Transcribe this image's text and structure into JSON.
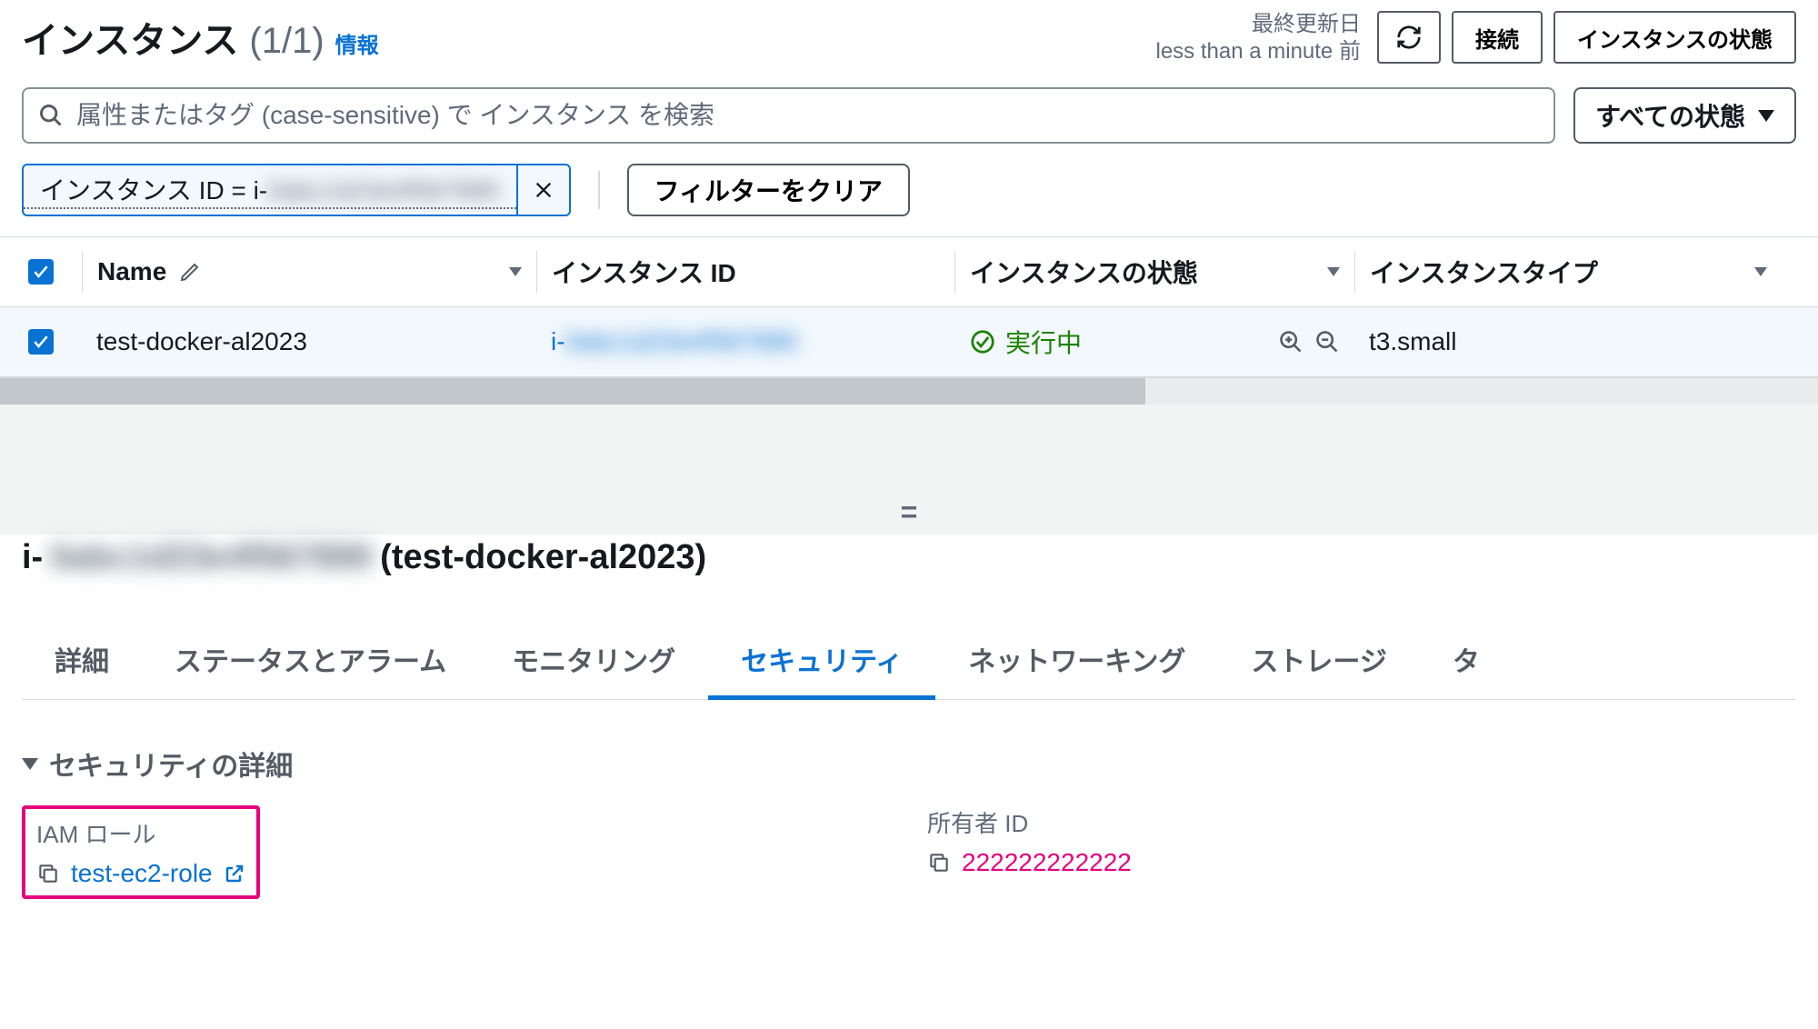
{
  "header": {
    "title": "インスタンス",
    "count": "(1/1)",
    "info_label": "情報",
    "last_updated_label": "最終更新日",
    "last_updated_value": "less than a minute 前",
    "connect_label": "接続",
    "state_action_label": "インスタンスの状態"
  },
  "search": {
    "placeholder": "属性またはタグ (case-sensitive) で インスタンス を検索",
    "state_filter_label": "すべての状態"
  },
  "chips": {
    "filter_prefix": "インスタンス ID = i-",
    "filter_hidden": "0abc1d23e4f567890",
    "clear_label": "フィルターをクリア"
  },
  "table": {
    "columns": {
      "name": "Name",
      "instance_id": "インスタンス ID",
      "state": "インスタンスの状態",
      "type": "インスタンスタイプ"
    },
    "row": {
      "name": "test-docker-al2023",
      "id_prefix": "i-",
      "id_hidden": "0abc1d23e4f567890",
      "state": "実行中",
      "type": "t3.small"
    }
  },
  "detail": {
    "id_prefix": "i-",
    "id_hidden": "0abc1d23e4f567890",
    "name_suffix": " (test-docker-al2023)",
    "tabs": {
      "details": "詳細",
      "status": "ステータスとアラーム",
      "monitoring": "モニタリング",
      "security": "セキュリティ",
      "networking": "ネットワーキング",
      "storage": "ストレージ",
      "tags": "タ"
    },
    "security_header": "セキュリティの詳細",
    "iam_label": "IAM ロール",
    "iam_value": "test-ec2-role",
    "owner_label": "所有者 ID",
    "owner_value": "222222222222"
  }
}
